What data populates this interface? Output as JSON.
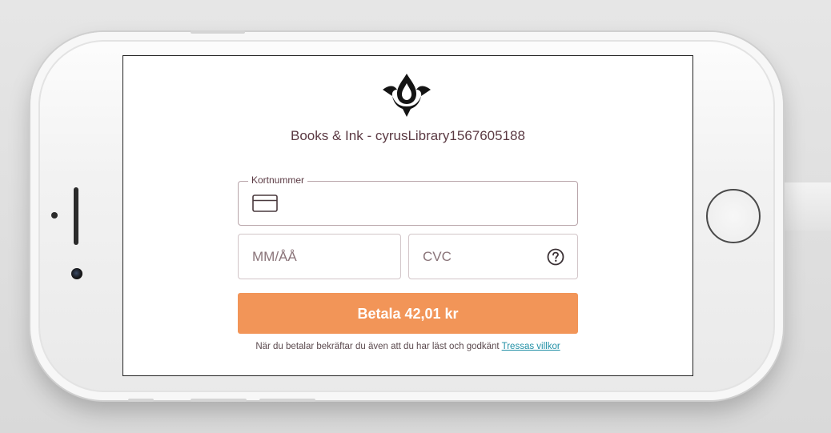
{
  "merchant": {
    "title": "Books & Ink - cyrusLibrary1567605188",
    "logo_icon": "flame-drop-logo-icon"
  },
  "card_number": {
    "label": "Kortnummer",
    "value": "",
    "icon": "credit-card-icon"
  },
  "expiry": {
    "placeholder": "MM/ÅÅ",
    "value": ""
  },
  "cvc": {
    "placeholder": "CVC",
    "value": "",
    "help_icon": "question-circle-icon"
  },
  "pay_button": {
    "label": "Betala 42,01 kr"
  },
  "terms": {
    "text": "När du betalar bekräftar du även att du har läst och godkänt",
    "link_text": "Tressas villkor"
  },
  "colors": {
    "accent": "#f29558",
    "text": "#5b3a43",
    "link": "#1f8fa5"
  }
}
